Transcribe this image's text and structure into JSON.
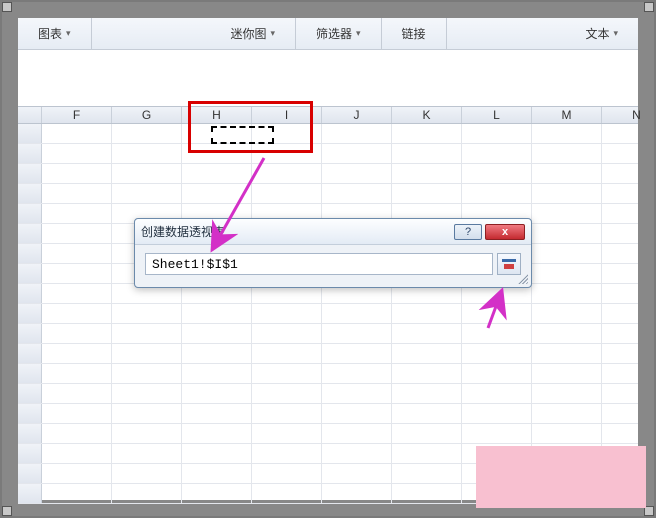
{
  "ribbon": {
    "chart": "图表",
    "sparkline": "迷你图",
    "filter": "筛选器",
    "link": "链接",
    "text": "文本"
  },
  "columns": [
    "F",
    "G",
    "H",
    "I",
    "J",
    "K",
    "L",
    "M",
    "N"
  ],
  "dialog": {
    "title": "创建数据透视表",
    "ref_value": "Sheet1!$I$1",
    "help_label": "?",
    "close_label": "x"
  }
}
